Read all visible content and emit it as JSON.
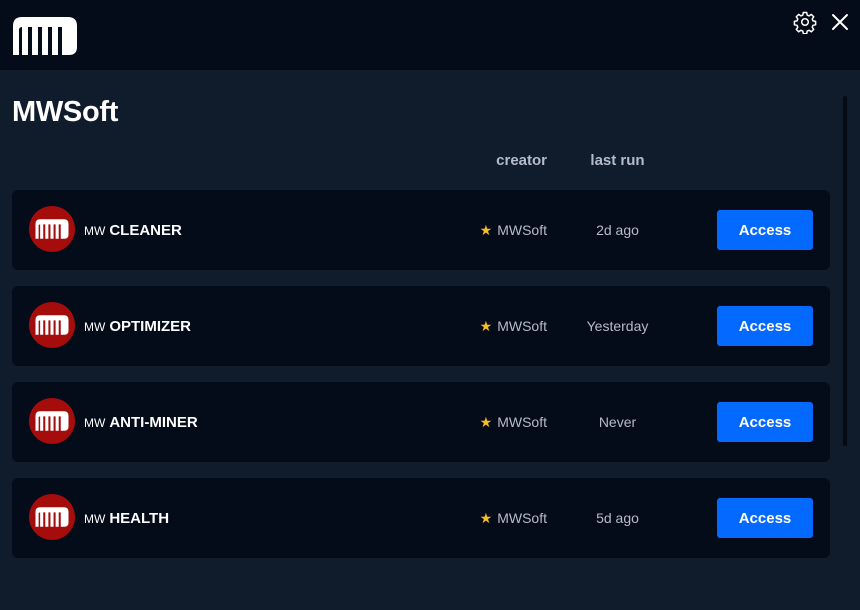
{
  "header": {
    "logo_icon": "mw-logo-icon",
    "settings_icon": "gear-icon",
    "close_icon": "close-icon"
  },
  "page": {
    "title": "MWSoft"
  },
  "columns": {
    "creator": "creator",
    "last_run": "last run"
  },
  "apps": [
    {
      "prefix": "MW",
      "name": "CLEANER",
      "creator": "MWSoft",
      "last_run": "2d ago",
      "action": "Access",
      "icon": "mw-logo-icon"
    },
    {
      "prefix": "MW",
      "name": "OPTIMIZER",
      "creator": "MWSoft",
      "last_run": "Yesterday",
      "action": "Access",
      "icon": "mw-logo-icon"
    },
    {
      "prefix": "MW",
      "name": "ANTI-MINER",
      "creator": "MWSoft",
      "last_run": "Never",
      "action": "Access",
      "icon": "mw-logo-icon"
    },
    {
      "prefix": "MW",
      "name": "HEALTH",
      "creator": "MWSoft",
      "last_run": "5d ago",
      "action": "Access",
      "icon": "mw-logo-icon"
    }
  ],
  "colors": {
    "background": "#101b2c",
    "header_background": "#050c19",
    "card_background": "#050c19",
    "accent_button": "#0469ff",
    "icon_badge": "#a50d0d",
    "star": "#f6be1e",
    "muted_text": "#b5bcc8"
  }
}
